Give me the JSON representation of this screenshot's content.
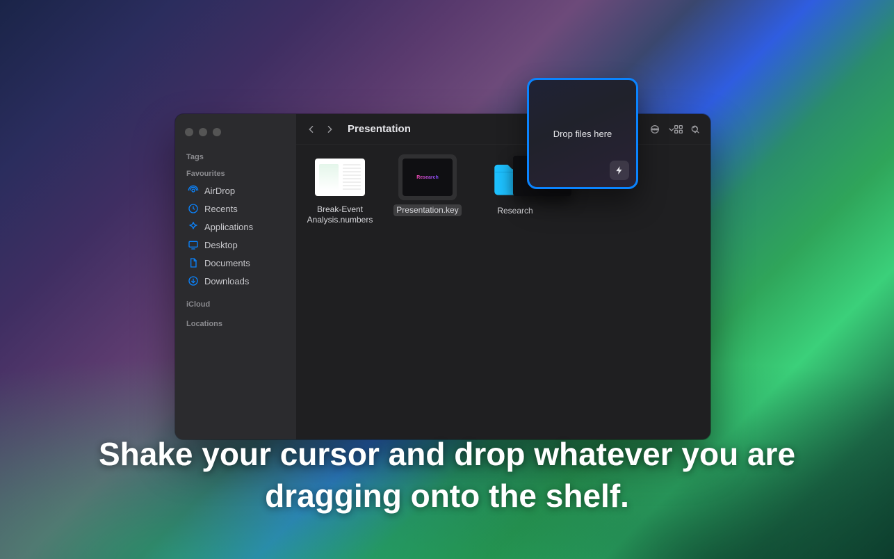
{
  "window": {
    "title": "Presentation"
  },
  "sidebar": {
    "sections": {
      "tags": "Tags",
      "favourites": "Favourites",
      "icloud": "iCloud",
      "locations": "Locations"
    },
    "items": [
      {
        "icon": "airdrop-icon",
        "label": "AirDrop"
      },
      {
        "icon": "clock-icon",
        "label": "Recents"
      },
      {
        "icon": "apps-icon",
        "label": "Applications"
      },
      {
        "icon": "desktop-icon",
        "label": "Desktop"
      },
      {
        "icon": "document-icon",
        "label": "Documents"
      },
      {
        "icon": "download-icon",
        "label": "Downloads"
      }
    ]
  },
  "files": [
    {
      "name": "Break-Event Analysis.numbers",
      "kind": "numbers",
      "selected": false
    },
    {
      "name": "Presentation.key",
      "kind": "key",
      "selected": true
    },
    {
      "name": "Research",
      "kind": "folder",
      "selected": false
    }
  ],
  "shelf": {
    "text": "Drop files here"
  },
  "drag": {
    "preview_label": "Research"
  },
  "caption": "Shake your cursor and drop whatever you are dragging onto the shelf."
}
